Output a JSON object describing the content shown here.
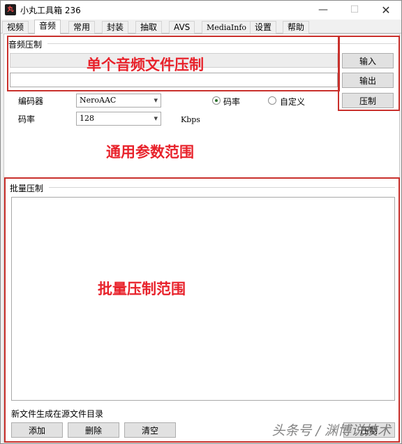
{
  "window": {
    "title": "小丸工具箱 236",
    "app_icon_text": "丸",
    "minimize_glyph": "—",
    "maximize_glyph": "☐",
    "close_glyph": "✕"
  },
  "tabs": [
    {
      "label": "视频"
    },
    {
      "label": "音频"
    },
    {
      "label": "常用"
    },
    {
      "label": "封装"
    },
    {
      "label": "抽取"
    },
    {
      "label": "AVS"
    },
    {
      "label": "MediaInfo"
    },
    {
      "label": "设置"
    },
    {
      "label": "帮助"
    }
  ],
  "active_tab": "音频",
  "audio_group": {
    "title": "音频压制",
    "input_value": "",
    "output_value": "",
    "input_button": "输入",
    "output_button": "输出",
    "encode_button": "压制"
  },
  "params": {
    "encoder_label": "编码器",
    "encoder_value": "NeroAAC",
    "bitrate_label": "码率",
    "bitrate_value": "128",
    "bitrate_unit": "Kbps",
    "radio_bitrate": "码率",
    "radio_custom": "自定义",
    "selected_radio": "码率"
  },
  "batch_group": {
    "title": "批量压制",
    "note": "新文件生成在源文件目录",
    "add_button": "添加",
    "delete_button": "删除",
    "clear_button": "清空",
    "encode_button": "压制"
  },
  "annotations": {
    "single": "单个音频文件压制",
    "common": "通用参数范围",
    "batch": "批量压制范围",
    "color": "#e8222b"
  },
  "watermark": "头条号 / 渊博说技术"
}
